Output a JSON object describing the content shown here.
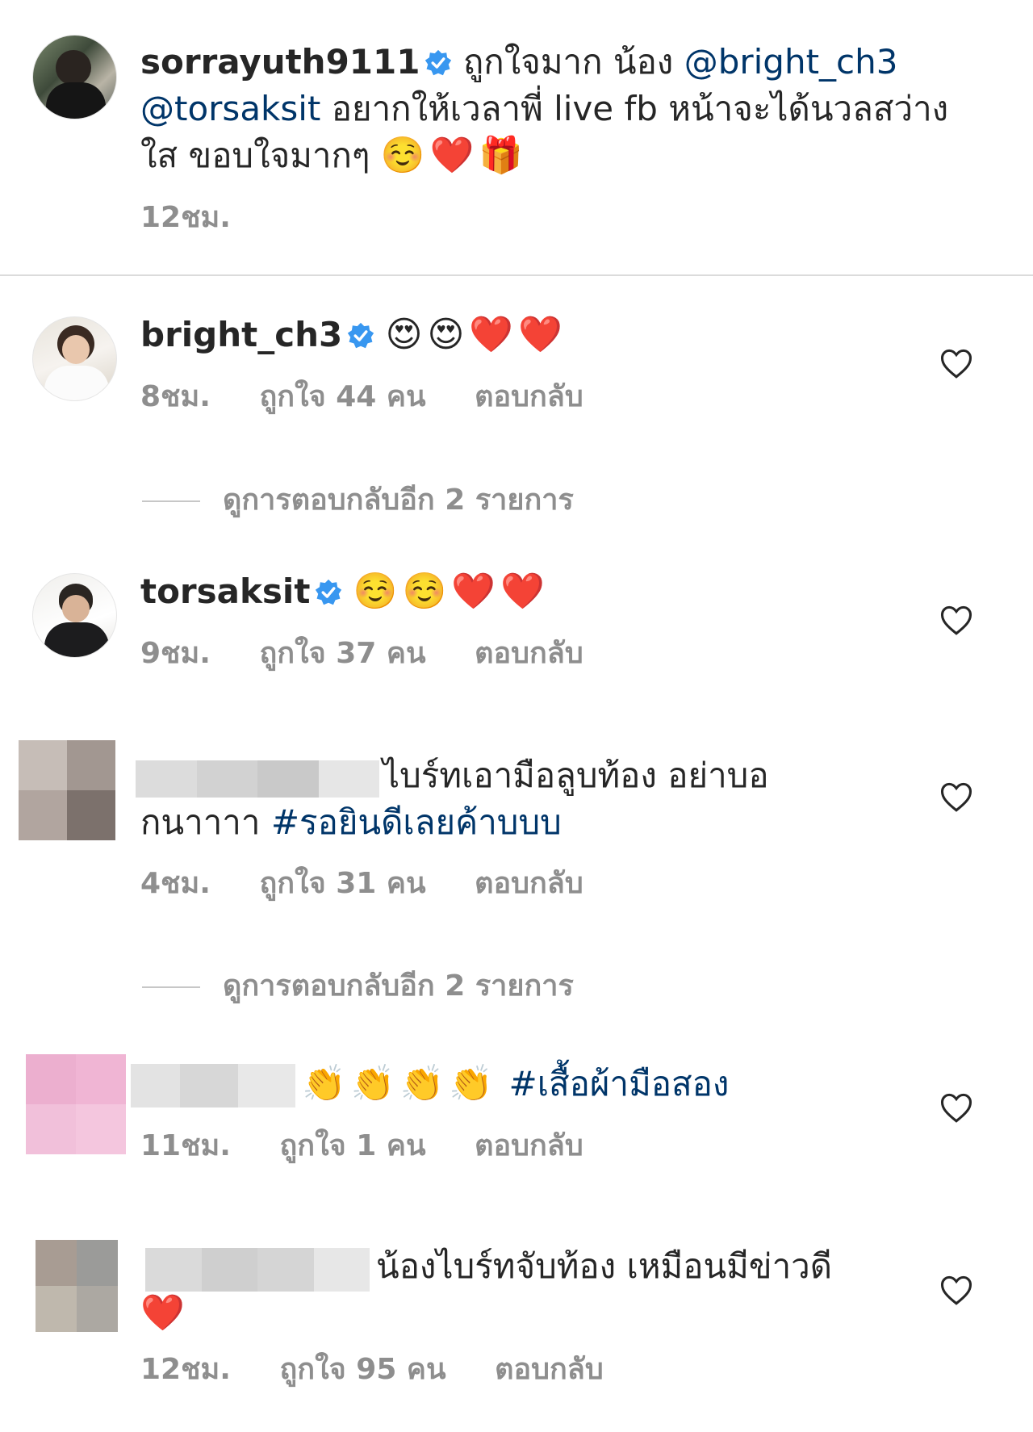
{
  "caption": {
    "username": "sorrayuth9111",
    "text_part1": "ถูกใจมาก น้อง",
    "mention1": "@bright_ch3",
    "mention2": "@torsaksit",
    "text_part2": "อยากให้เวลาพี่ live fb หน้าจะได้นวลสว่าง",
    "text_part3": "ใส ขอบใจมากๆ",
    "emojis": "☺️❤️🎁",
    "time": "12ชม."
  },
  "comments": [
    {
      "username": "bright_ch3",
      "emojis": "😍😍❤️❤️",
      "time": "8ชม.",
      "likes": "ถูกใจ 44 คน",
      "reply": "ตอบกลับ"
    },
    {
      "username": "torsaksit",
      "emojis": "☺️☺️❤️❤️",
      "time": "9ชม.",
      "likes": "ถูกใจ 37 คน",
      "reply": "ตอบกลับ"
    },
    {
      "text_line1": "ไบร์ทเอามือลูบท้อง อย่าบอ",
      "text_line2": "กนาาาา",
      "hashtag": "#รอยินดีเลยค้าบบบ",
      "time": "4ชม.",
      "likes": "ถูกใจ 31 คน",
      "reply": "ตอบกลับ"
    },
    {
      "emojis": "👏👏👏👏",
      "hashtag": "#เสื้อผ้ามือสอง",
      "time": "11ชม.",
      "likes": "ถูกใจ 1 คน",
      "reply": "ตอบกลับ"
    },
    {
      "text_line1": "น้องไบร์ทจับท้อง เหมือนมีข่าวดี",
      "emojis": "❤️",
      "time": "12ชม.",
      "likes": "ถูกใจ 95 คน",
      "reply": "ตอบกลับ"
    }
  ],
  "view_replies_1": "ดูการตอบกลับอีก 2 รายการ",
  "view_replies_2": "ดูการตอบกลับอีก 2 รายการ",
  "colors": {
    "text": "#262626",
    "muted": "#8e8e8e",
    "link": "#003569",
    "verified": "#3897f0",
    "heart": "#ed4956"
  },
  "icons": [
    "verified-badge-icon",
    "heart-outline-icon"
  ]
}
